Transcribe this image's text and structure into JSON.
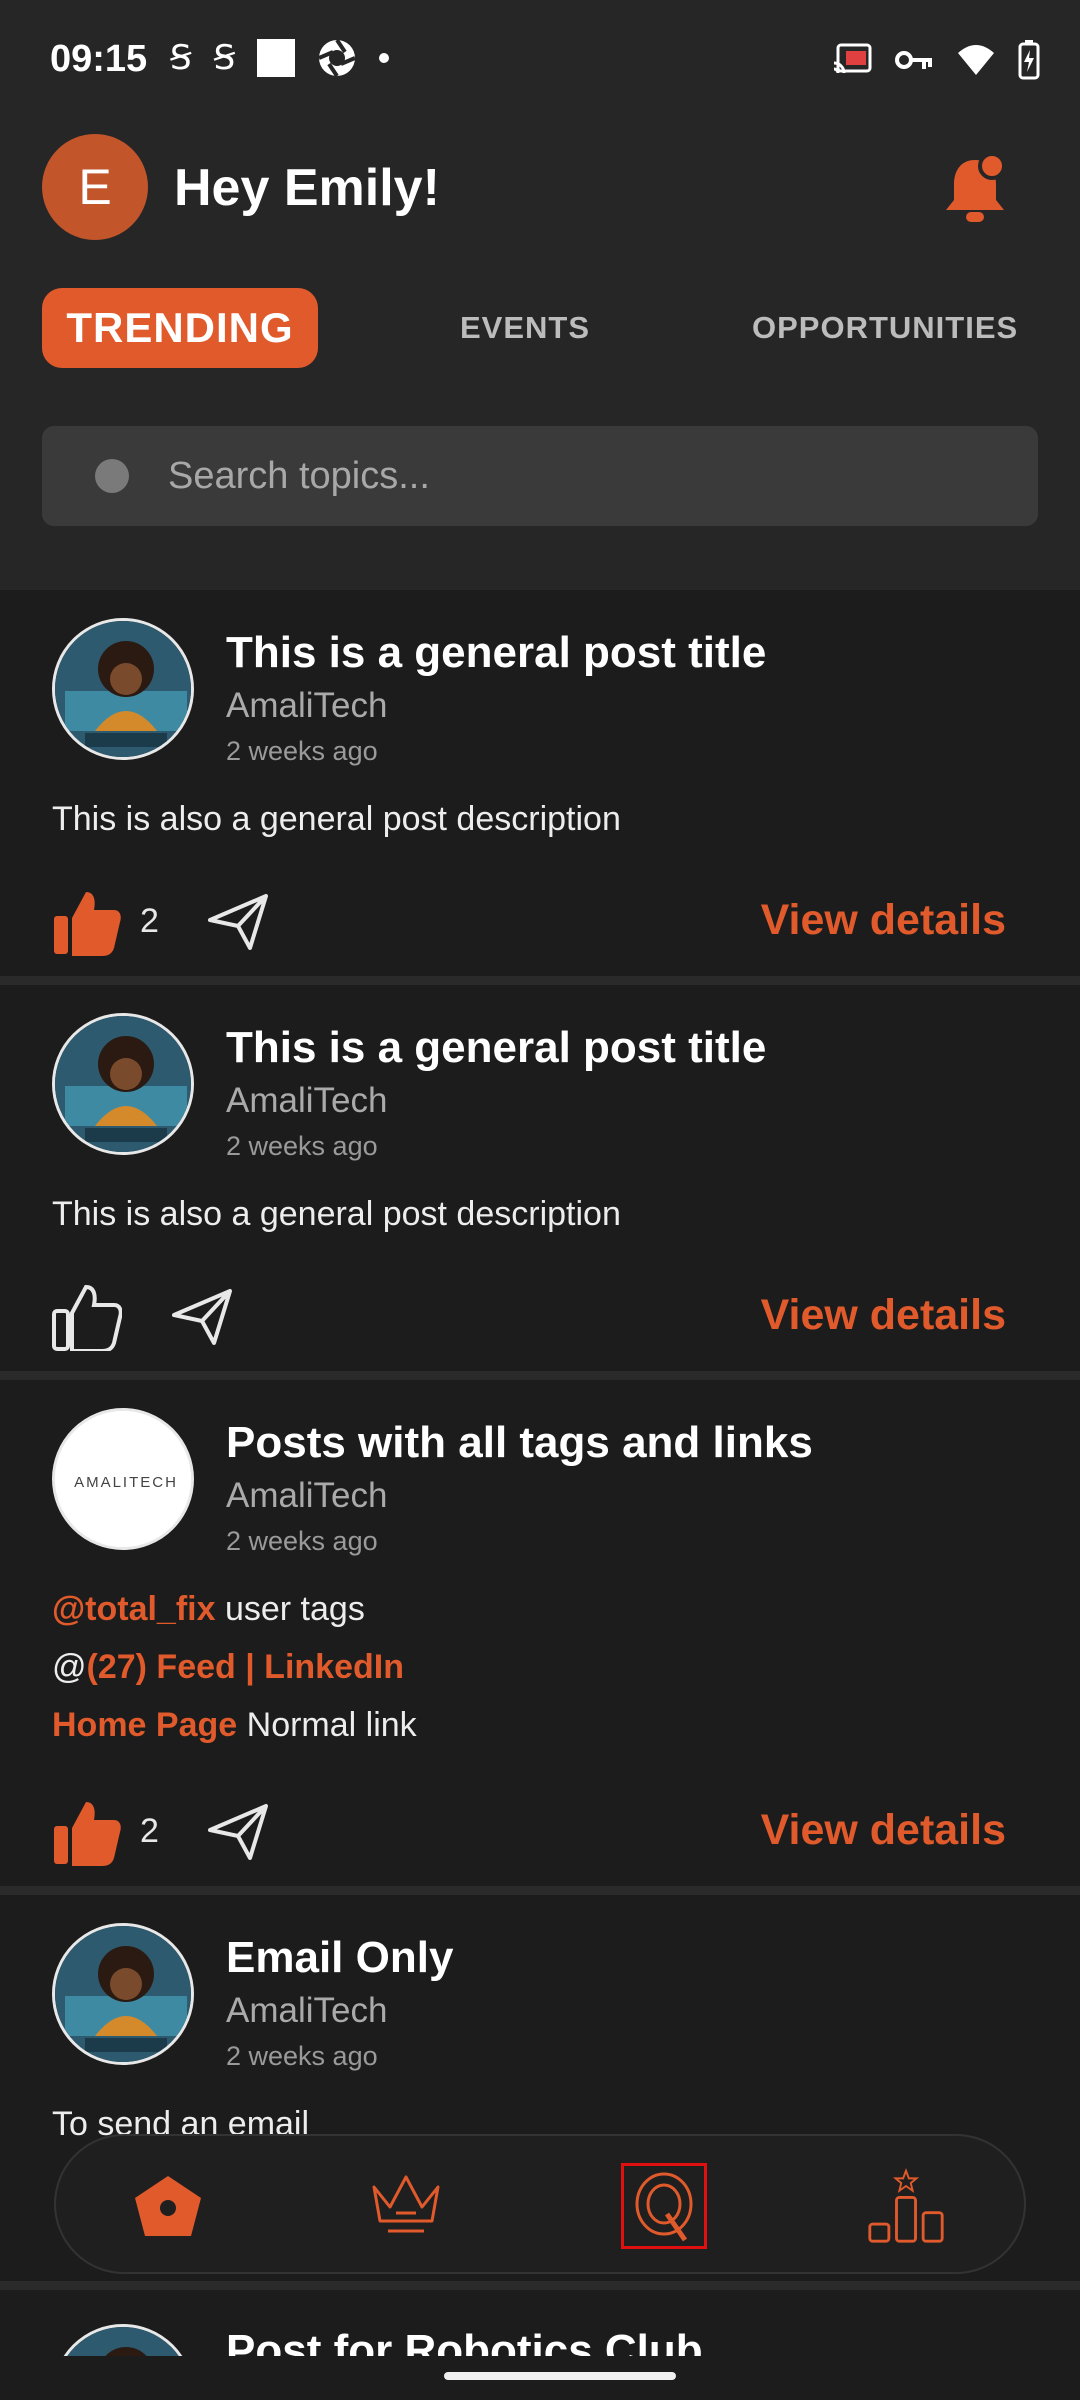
{
  "status_bar": {
    "time": "09:15"
  },
  "header": {
    "avatar_letter": "E",
    "greeting": "Hey Emily!",
    "tabs": [
      {
        "label": "TRENDING",
        "active": true
      },
      {
        "label": "EVENTS",
        "active": false
      },
      {
        "label": "OPPORTUNITIES",
        "active": false
      }
    ],
    "search": {
      "placeholder": "Search topics..."
    }
  },
  "posts": [
    {
      "title": "This is a general post title",
      "author": "AmaliTech",
      "time": "2 weeks ago",
      "description": "This is also a general post description",
      "likes": "2",
      "liked": true,
      "view_label": "View details"
    },
    {
      "title": "This is a general post title",
      "author": "AmaliTech",
      "time": "2 weeks ago",
      "description": "This is also a general post description",
      "likes": "",
      "liked": false,
      "view_label": "View details"
    },
    {
      "title": "Posts with all tags and links",
      "author": "AmaliTech",
      "time": "2 weeks ago",
      "logo_text": "AMALITECH",
      "lines": [
        {
          "tag": "@total_fix",
          "text": " user tags",
          "prefix": ""
        },
        {
          "prefix": "@",
          "tag": "(27) Feed | LinkedIn",
          "text": ""
        },
        {
          "tag": "Home Page",
          "text": " Normal link",
          "prefix": ""
        }
      ],
      "likes": "2",
      "liked": true,
      "view_label": "View details"
    },
    {
      "title": "Email Only",
      "author": "AmaliTech",
      "time": "2 weeks ago",
      "description": "To send an email"
    },
    {
      "title": "Post for Robotics Club"
    }
  ],
  "bottom_nav": [
    "home-icon",
    "crown-icon",
    "q-icon",
    "leaderboard-icon"
  ],
  "colors": {
    "accent": "#e05a2b",
    "background": "#1c1c1c",
    "header": "#262626"
  }
}
